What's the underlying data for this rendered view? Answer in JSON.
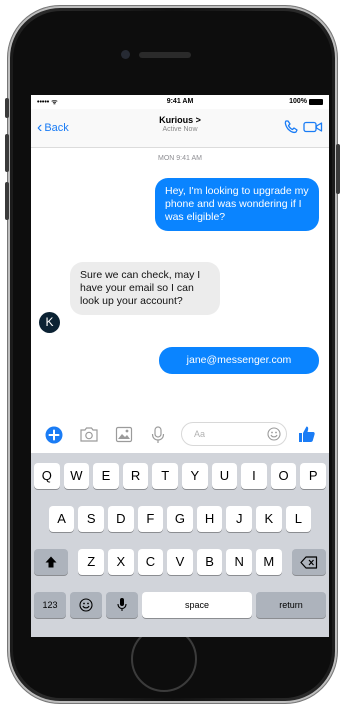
{
  "status_bar": {
    "signal": "••••• ᯤ",
    "time": "9:41 AM",
    "battery": "100%"
  },
  "nav": {
    "back_label": "Back",
    "contact_name": "Kurious >",
    "contact_status": "Active Now"
  },
  "timestamp": "MON 9:41 AM",
  "messages": [
    {
      "from": "me",
      "text": "Hey, I'm looking to upgrade my phone and was wondering if I was eligible?"
    },
    {
      "from": "them",
      "text": "Sure we can check, may I have your email so I can look up your account?"
    },
    {
      "from": "me",
      "text": "jane@messenger.com"
    }
  ],
  "avatar_letter": "K",
  "composer": {
    "placeholder": "Aa"
  },
  "keyboard": {
    "row1": [
      "Q",
      "W",
      "E",
      "R",
      "T",
      "Y",
      "U",
      "I",
      "O",
      "P"
    ],
    "row2": [
      "A",
      "S",
      "D",
      "F",
      "G",
      "H",
      "J",
      "K",
      "L"
    ],
    "row3": [
      "Z",
      "X",
      "C",
      "V",
      "B",
      "N",
      "M"
    ],
    "numbers_label": "123",
    "space_label": "space",
    "return_label": "return"
  },
  "colors": {
    "accent": "#0a84ff",
    "incoming_bubble": "#ececec"
  }
}
